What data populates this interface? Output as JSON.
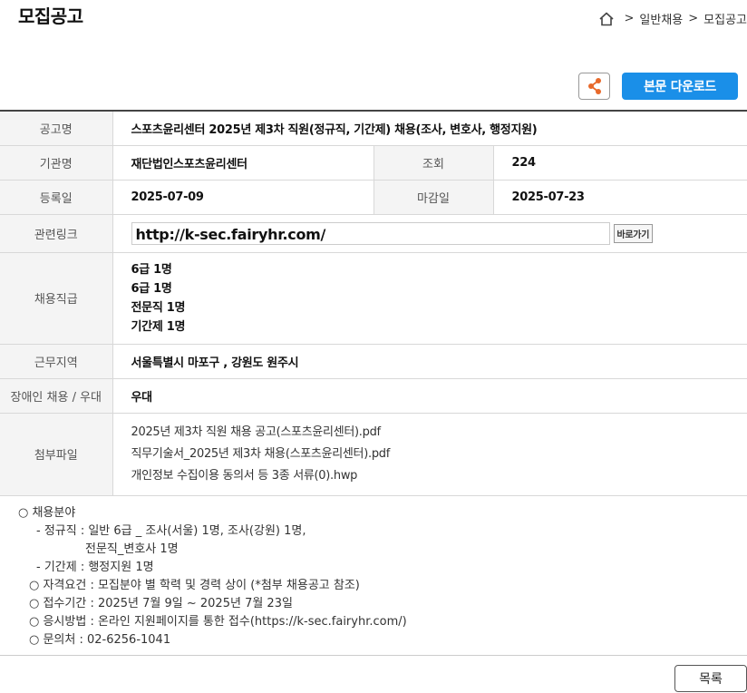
{
  "page": {
    "title": "모집공고"
  },
  "breadcrumb": {
    "sep": ">",
    "items": [
      "일반채용",
      "모집공고"
    ]
  },
  "toolbar": {
    "share_icon": "share-icon",
    "download_label": "본문 다운로드"
  },
  "colors": {
    "accent": "#1a8fe8",
    "share_icon": "#e8692a"
  },
  "info": {
    "title_label": "공고명",
    "title_value": "스포츠윤리센터 2025년 제3차 직원(정규직, 기간제) 채용(조사, 변호사, 행정지원)",
    "org_label": "기관명",
    "org_value": "재단법인스포츠윤리센터",
    "views_label": "조회",
    "views_value": "224",
    "reg_label": "등록일",
    "reg_value": "2025-07-09",
    "deadline_label": "마감일",
    "deadline_value": "2025-07-23",
    "link_label": "관련링크",
    "link_value": "http://k-sec.fairyhr.com/",
    "goto_label": "바로가기",
    "positions_label": "채용직급",
    "positions": [
      "6급 1명",
      "6급 1명",
      "전문직 1명",
      "기간제 1명"
    ],
    "region_label": "근무지역",
    "region_value": "서울특별시 마포구 , 강원도 원주시",
    "disabled_label": "장애인 채용 / 우대",
    "disabled_value": "우대",
    "files_label": "첨부파일",
    "files": [
      "2025년 제3차 직원 채용 공고(스포츠윤리센터).pdf",
      "직무기술서_2025년 제3차 채용(스포츠윤리센터).pdf",
      "개인정보 수집이용 동의서 등 3종 서류(0).hwp"
    ]
  },
  "details": {
    "line1": "○ 채용분야",
    "line2": "- 정규직 : 일반 6급 _ 조사(서울) 1명, 조사(강원) 1명,",
    "line3": "전문직_변호사 1명",
    "line4": "- 기간제 : 행정지원 1명",
    "line5": "○ 자격요건 : 모집분야 별 학력 및 경력 상이 (*첨부 채용공고 참조)",
    "line6": "○ 접수기간 : 2025년 7월 9일 ~ 2025년 7월 23일",
    "line7": "○ 응시방법 : 온라인 지원페이지를 통한 접수(https://k-sec.fairyhr.com/)",
    "line8": "○ 문의처 : 02-6256-1041"
  },
  "footer": {
    "list_label": "목록"
  }
}
